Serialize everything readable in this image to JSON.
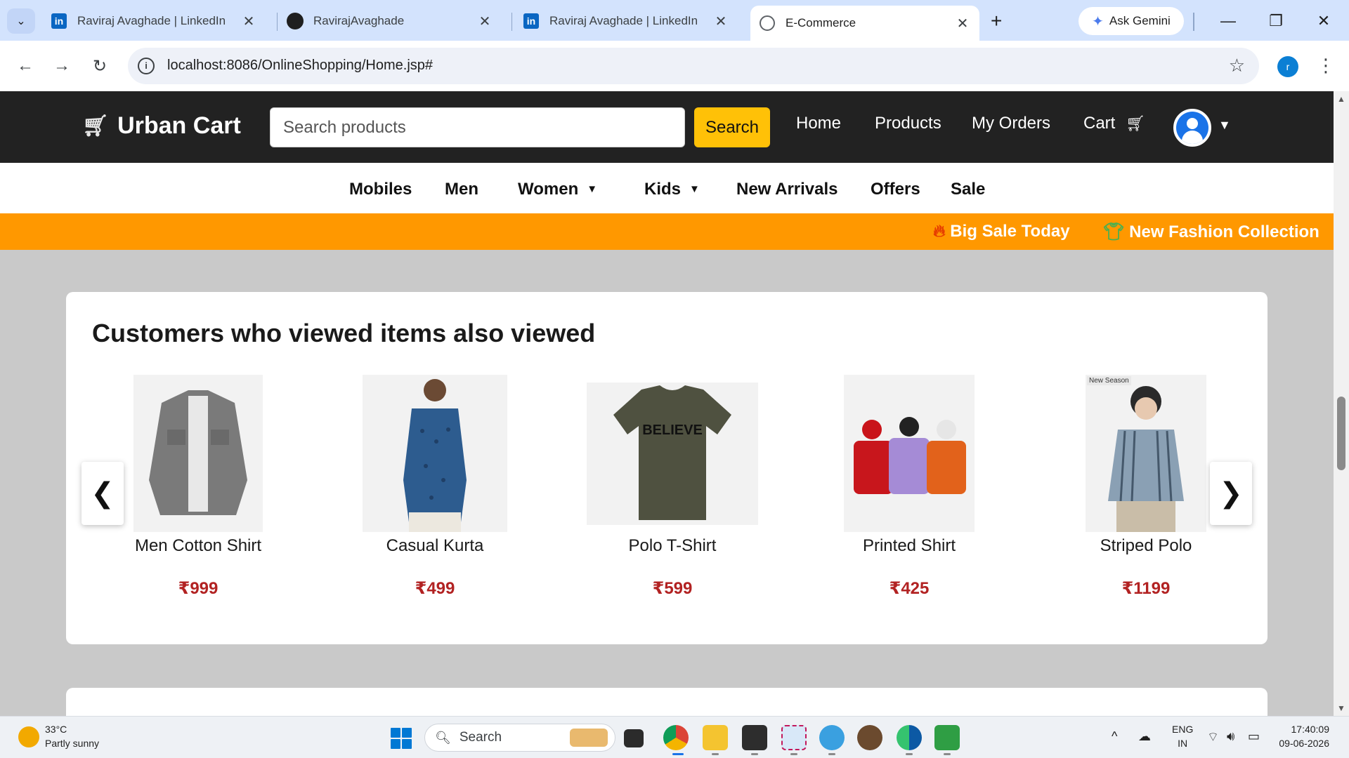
{
  "browser": {
    "tab_search_icon": "chevron-down-icon",
    "tabs": [
      {
        "title": "Raviraj Avaghade | LinkedIn",
        "icon": "linkedin-icon",
        "active": false
      },
      {
        "title": "RavirajAvaghade",
        "icon": "github-icon",
        "active": false
      },
      {
        "title": "Raviraj Avaghade | LinkedIn",
        "icon": "linkedin-icon",
        "active": false
      },
      {
        "title": "E-Commerce",
        "icon": "globe-icon",
        "active": true
      }
    ],
    "tab_close_glyph": "✕",
    "new_tab_glyph": "+",
    "gemini_label": "Ask Gemini",
    "url": "localhost:8086/OnlineShopping/Home.jsp#",
    "profile_initial": "r",
    "accent": "#d3e3fd"
  },
  "site": {
    "brand": "Urban Cart",
    "search": {
      "placeholder": "Search products",
      "button": "Search"
    },
    "nav": {
      "home": "Home",
      "products": "Products",
      "orders": "My Orders",
      "cart": "Cart"
    },
    "categories": [
      {
        "label": "Mobiles",
        "dropdown": false
      },
      {
        "label": "Men",
        "dropdown": false
      },
      {
        "label": "Women",
        "dropdown": true
      },
      {
        "label": "Kids",
        "dropdown": true
      },
      {
        "label": "New Arrivals",
        "dropdown": false
      },
      {
        "label": "Offers",
        "dropdown": false
      },
      {
        "label": "Sale",
        "dropdown": false
      }
    ],
    "promos": [
      {
        "icon": "fire-icon",
        "text": "Big Sale Today"
      },
      {
        "icon": "tshirt-icon",
        "text": "New Fashion Collection"
      }
    ],
    "colors": {
      "header": "#222222",
      "search_button": "#ffc107",
      "promo_bar": "#ff9800",
      "price": "#b22222"
    }
  },
  "recommendations": {
    "title": "Customers who viewed items also viewed",
    "prev_glyph": "❮",
    "next_glyph": "❯",
    "products": [
      {
        "name": "Men Cotton Shirt",
        "price": "₹999",
        "badge": ""
      },
      {
        "name": "Casual Kurta",
        "price": "₹499",
        "badge": ""
      },
      {
        "name": "Polo T-Shirt",
        "price": "₹599",
        "badge": "",
        "print": "BELIEVE"
      },
      {
        "name": "Printed Shirt",
        "price": "₹425",
        "badge": ""
      },
      {
        "name": "Striped Polo",
        "price": "₹1199",
        "badge": "New Season"
      }
    ]
  },
  "taskbar": {
    "weather": {
      "temp": "33°C",
      "desc": "Partly sunny"
    },
    "search_label": "Search",
    "lang": {
      "line1": "ENG",
      "line2": "IN"
    },
    "time": "17:40:09",
    "date": "09-06-2026"
  }
}
